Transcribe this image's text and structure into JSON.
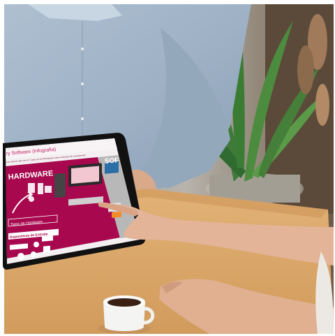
{
  "tablet": {
    "header_title": "ry Software (Infografía)",
    "subheader": "Los nuevos ojos con lo T para ver la información sobre cada tipo de componente",
    "hardware_title": "HARDWARE",
    "software_title_partial": "SOF",
    "tipos_label": "Tipos de Hardware",
    "dispositivos_label": "Dispositivos de Entrada",
    "colors": {
      "panel_magenta": "#a7084e",
      "panel_gray": "#b9b8b8",
      "header_white": "#f8f4f6",
      "title_pink": "#c2185b"
    }
  }
}
